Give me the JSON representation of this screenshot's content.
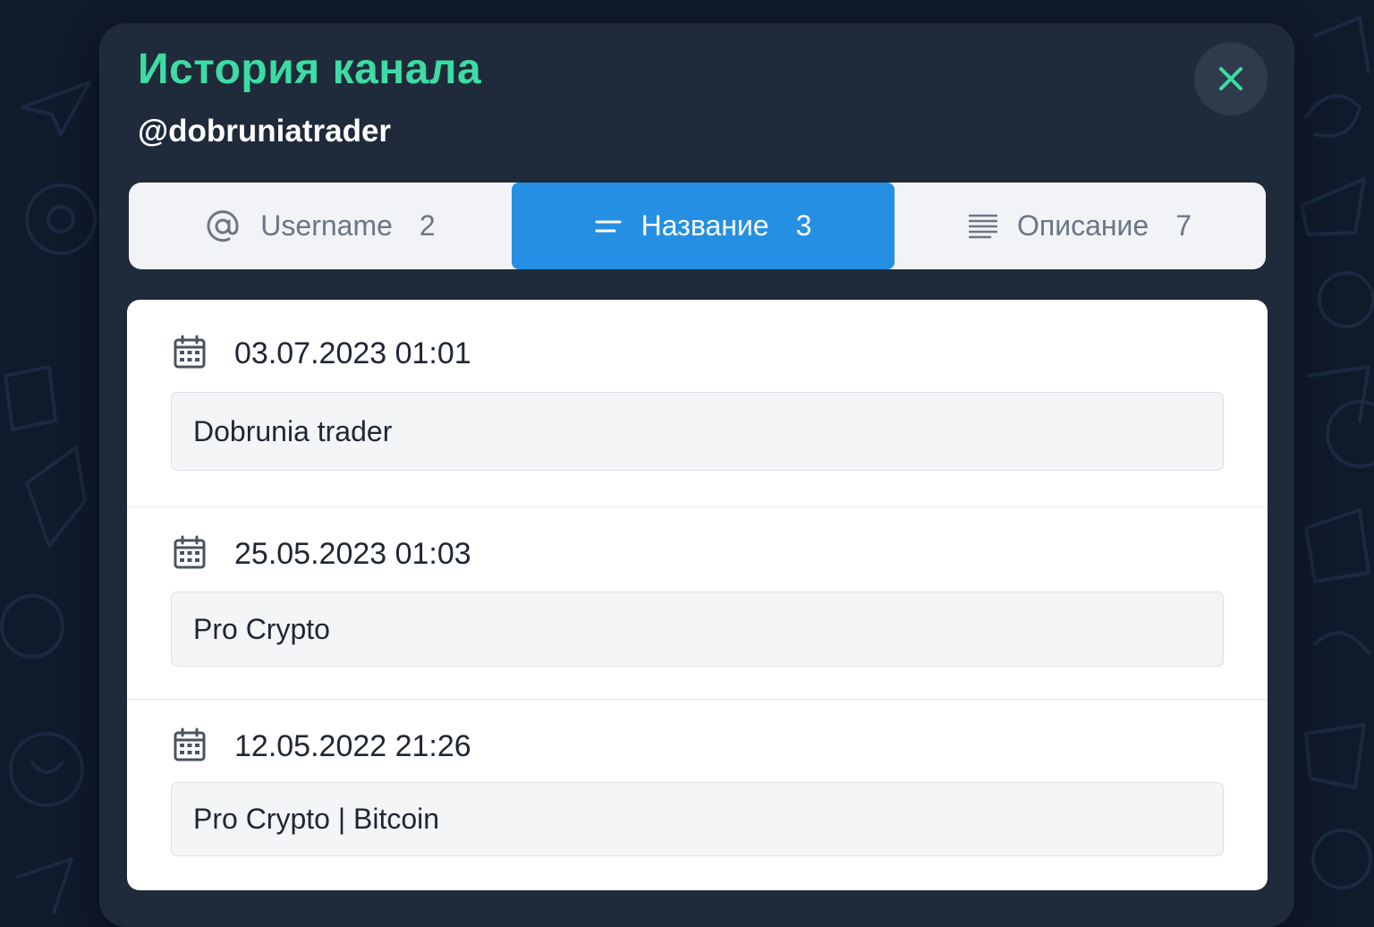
{
  "modal": {
    "title": "История канала",
    "subtitle": "@dobruniatrader",
    "close_icon": "close-icon"
  },
  "tabs": [
    {
      "icon": "at-sign-icon",
      "label": "Username",
      "count": "2",
      "active": false
    },
    {
      "icon": "title-lines-icon",
      "label": "Название",
      "count": "3",
      "active": true
    },
    {
      "icon": "description-lines-icon",
      "label": "Описание",
      "count": "7",
      "active": false
    }
  ],
  "history": [
    {
      "icon": "calendar-icon",
      "date": "03.07.2023 01:01",
      "value": "Dobrunia trader"
    },
    {
      "icon": "calendar-icon",
      "date": "25.05.2023 01:03",
      "value": "Pro Crypto"
    },
    {
      "icon": "calendar-icon",
      "date": "12.05.2022 21:26",
      "value": "Pro Crypto | Bitcoin"
    }
  ],
  "colors": {
    "background": "#0f1a2b",
    "modal": "#1f2a3b",
    "title_accent": "#3ddca4",
    "active_tab": "#2590e3",
    "tab_bar": "#f1f3f6",
    "text_dark": "#1f2733",
    "text_muted": "#6b7685"
  }
}
